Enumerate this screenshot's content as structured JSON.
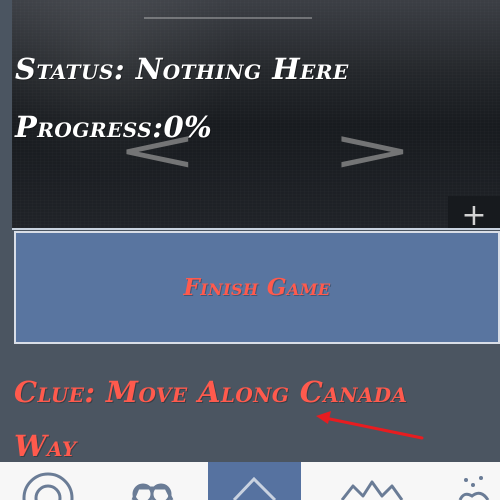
{
  "camera": {
    "previous_label": "<",
    "next_label": ">",
    "plus_label": "+"
  },
  "status": {
    "text": "Status: Nothing Here"
  },
  "progress": {
    "text": "Progress:0%"
  },
  "finish_button": {
    "label": "Finish Game"
  },
  "clue": {
    "text": "Clue: Move Along Canada Way"
  },
  "bottom_nav": {
    "items": [
      {
        "icon": "target-icon"
      },
      {
        "icon": "camera-icon"
      },
      {
        "icon": "chevron-up-icon"
      },
      {
        "icon": "crown-icon"
      },
      {
        "icon": "sparkle-icon"
      }
    ]
  },
  "colors": {
    "background": "#4b5561",
    "button_blue": "#5975a0",
    "clue_red": "#ff5a4d",
    "bottom_nav": "#f7f7f7",
    "nav_active": "#5672a0"
  }
}
